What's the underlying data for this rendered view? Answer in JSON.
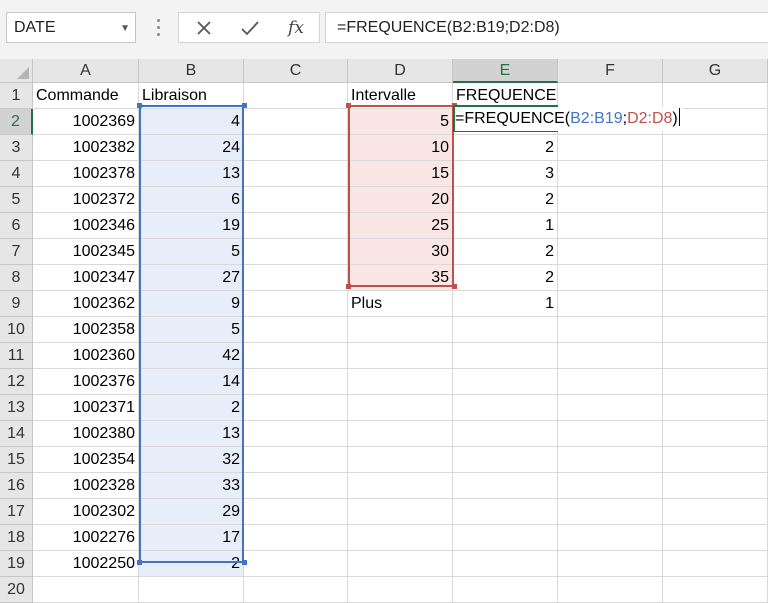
{
  "name_box": {
    "value": "DATE"
  },
  "formula_bar": {
    "cancel_icon": "x-icon",
    "enter_icon": "check-icon",
    "fx_label": "fx",
    "formula": "=FREQUENCE(B2:B19;D2:D8)"
  },
  "columns": [
    "A",
    "B",
    "C",
    "D",
    "E",
    "F",
    "G"
  ],
  "rows": [
    "1",
    "2",
    "3",
    "4",
    "5",
    "6",
    "7",
    "8",
    "9",
    "10",
    "11",
    "12",
    "13",
    "14",
    "15",
    "16",
    "17",
    "18",
    "19",
    "20"
  ],
  "headers": {
    "commande": "Commande",
    "libraison": "Libraison",
    "intervalle": "Intervalle",
    "frequence": "FREQUENCE"
  },
  "commandes": [
    "1002369",
    "1002382",
    "1002378",
    "1002372",
    "1002346",
    "1002345",
    "1002347",
    "1002362",
    "1002358",
    "1002360",
    "1002376",
    "1002371",
    "1002380",
    "1002354",
    "1002328",
    "1002302",
    "1002276",
    "1002250"
  ],
  "libraisons": [
    "4",
    "24",
    "13",
    "6",
    "19",
    "5",
    "27",
    "9",
    "5",
    "42",
    "14",
    "2",
    "13",
    "32",
    "33",
    "29",
    "17",
    "2"
  ],
  "intervalles": [
    "5",
    "10",
    "15",
    "20",
    "25",
    "30",
    "35"
  ],
  "plus_label": "Plus",
  "frequences": [
    "",
    "2",
    "3",
    "2",
    "1",
    "2",
    "2",
    "1"
  ],
  "editing": {
    "prefix": "=FREQUENCE(",
    "ref1": "B2:B19",
    "sep": ";",
    "ref2": "D2:D8",
    "suffix": ")"
  },
  "colors": {
    "accent_green": "#217346",
    "range_blue": "#4472c4",
    "range_red": "#c0504d"
  }
}
